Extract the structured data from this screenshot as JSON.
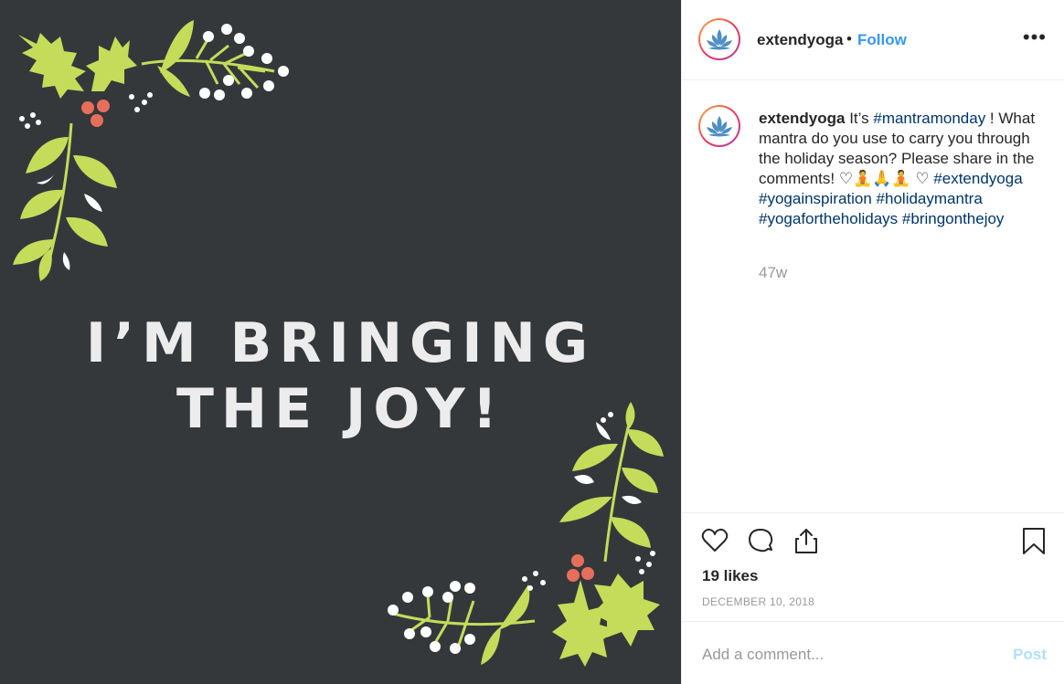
{
  "post": {
    "headline_line1": "I’M BRINGING",
    "headline_line2": "THE JOY!"
  },
  "header": {
    "username": "extendyoga",
    "separator": "•",
    "follow_label": "Follow",
    "more_label": "•••"
  },
  "caption": {
    "username": "extendyoga",
    "text_1": " It’s ",
    "tag_1": "#mantramonday",
    "text_2": " ! What mantra do you use to carry you through the holiday season? Please share in the comments! ♡🧘🙏🧘 ♡ ",
    "tag_2": "#extendyoga",
    "tag_3": "#yogainspiration",
    "tag_4": "#holidaymantra",
    "tag_5": "#yogafortheholidays",
    "tag_6": "#bringonthejoy",
    "time_ago": "47w"
  },
  "stats": {
    "likes": "19 likes",
    "date": "DECEMBER 10, 2018"
  },
  "comment_box": {
    "placeholder": "Add a comment...",
    "post_label": "Post"
  },
  "icons": [
    "heart-icon",
    "comment-icon",
    "share-icon",
    "bookmark-icon",
    "lotus-icon"
  ],
  "colors": {
    "background": "#35383b",
    "leaf": "#c5dc5a",
    "berry": "#e66f5c",
    "link": "#3897f0",
    "hashtag": "#003569"
  }
}
